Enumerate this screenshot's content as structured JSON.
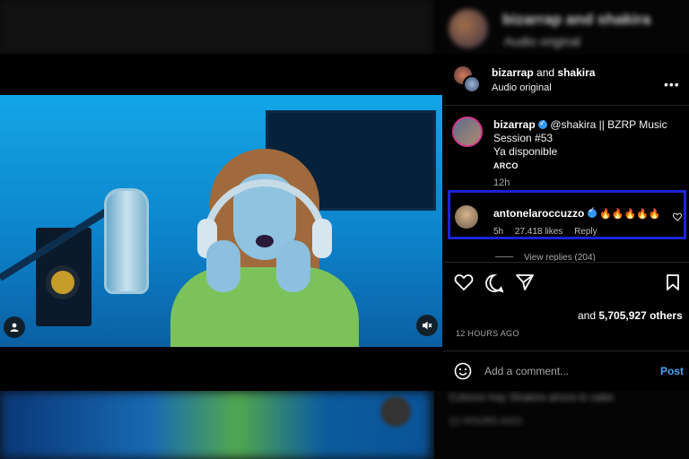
{
  "background": {
    "blurred_title": "bizarrap and shakira",
    "blurred_subtitle": "Audio original",
    "blurred_comment": "Colores hay Shakira ahora lo sabe",
    "blurred_time": "12 HOURS AGO"
  },
  "header": {
    "user1": "bizarrap",
    "and_text": "and",
    "user2": "shakira",
    "subtitle": "Audio original",
    "more_label": "•••"
  },
  "caption": {
    "username": "bizarrap",
    "text_line": "@shakira || BZRP Music Session #53",
    "second_line": "Ya disponible",
    "tag": "ARCO",
    "time": "12h"
  },
  "comment": {
    "username": "antonelaroccuzzo",
    "emojis": "🔥🔥🔥🔥🔥",
    "time": "5h",
    "likes": "27.418 likes",
    "reply": "Reply"
  },
  "view_replies": "View replies (204)",
  "post": {
    "likes_prefix": "and",
    "likes_count": "5,705,927 others",
    "time_ago": "12 HOURS AGO",
    "add_comment_placeholder": "Add a comment...",
    "post_button": "Post"
  },
  "colors": {
    "highlight_border": "#1a24d6",
    "link_blue": "#4ca3f5",
    "verified_blue": "#3897f0"
  }
}
